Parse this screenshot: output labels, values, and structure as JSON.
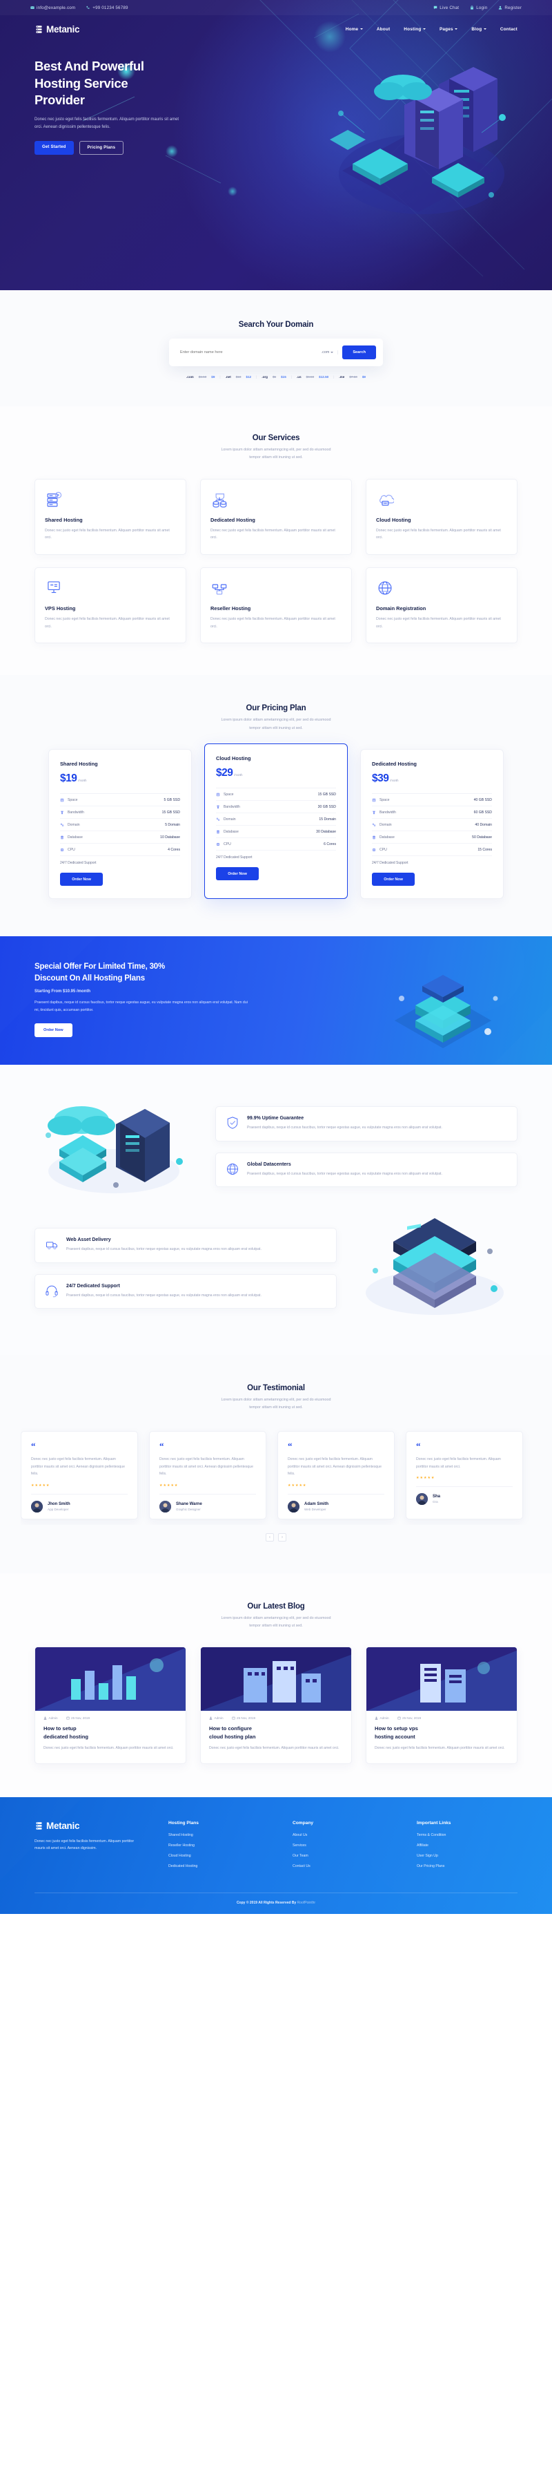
{
  "topbar": {
    "email": "info@example.com",
    "phone": "+99 01234 56789",
    "live_chat": "Live Chat",
    "login": "Login",
    "register": "Register"
  },
  "brand": {
    "name": "Metanic"
  },
  "nav": [
    {
      "label": "Home",
      "caret": true
    },
    {
      "label": "About",
      "caret": false
    },
    {
      "label": "Hosting",
      "caret": true
    },
    {
      "label": "Pages",
      "caret": true
    },
    {
      "label": "Blog",
      "caret": true
    },
    {
      "label": "Contact",
      "caret": false
    }
  ],
  "hero": {
    "title_l1": "Best And Powerful",
    "title_l2": "Hosting Service",
    "title_l3": "Provider",
    "paragraph": "Donec nec justo eget felis facilisis fermentum. Aliquam porttitor mauris sit amet orci. Aenean dignissim pellentesque felis.",
    "btn_primary": "Get Started",
    "btn_ghost": "Pricing Plans"
  },
  "search": {
    "title": "Search Your Domain",
    "placeholder": "Enter domain name here",
    "tld_selected": ".com",
    "button": "Search",
    "tlds": [
      {
        "ext": ".com",
        "old": "$6.50",
        "new": "$9"
      },
      {
        "ext": ".net",
        "old": "$10",
        "new": "$12"
      },
      {
        "ext": ".org",
        "old": "$5",
        "new": "$15"
      },
      {
        "ext": ".us",
        "old": "$6.50",
        "new": "$12.50"
      },
      {
        "ext": ".me",
        "old": "$7.50",
        "new": "$9"
      }
    ]
  },
  "services": {
    "title": "Our Services",
    "sub_l1": "Lorem ipsum dolor sittam ametamngcing elit, per sed do eiusmood",
    "sub_l2": "tempor sittam elit inuning ut sed.",
    "items": [
      {
        "icon": "server-icon",
        "title": "Shared Hosting",
        "desc": "Donec nec justo eget felis facilisis fermentum. Aliquam porttitor mauris sit amet orci."
      },
      {
        "icon": "database-icon",
        "title": "Dedicated Hosting",
        "desc": "Donec nec justo eget felis facilisis fermentum. Aliquam porttitor mauris sit amet orci."
      },
      {
        "icon": "cloud-icon",
        "title": "Cloud Hosting",
        "desc": "Donec nec justo eget felis facilisis fermentum. Aliquam porttitor mauris sit amet orci."
      },
      {
        "icon": "vps-icon",
        "title": "VPS Hosting",
        "desc": "Donec nec justo eget felis facilisis fermentum. Aliquam porttitor mauris sit amet orci."
      },
      {
        "icon": "reseller-icon",
        "title": "Reseller Hosting",
        "desc": "Donec nec justo eget felis facilisis fermentum. Aliquam porttitor mauris sit amet orci."
      },
      {
        "icon": "domain-icon",
        "title": "Domain Registration",
        "desc": "Donec nec justo eget felis facilisis fermentum. Aliquam porttitor mauris sit amet orci."
      }
    ]
  },
  "pricing": {
    "title": "Our Pricing Plan",
    "sub_l1": "Lorem ipsum dolor sittam ametamngcing elit, per sed do eiusmood",
    "sub_l2": "tempor sittam elit inuning ut sed.",
    "feature_labels": [
      "Space",
      "Bandwidth",
      "Domain",
      "Database",
      "CPU"
    ],
    "note": "24/7 Dedicated Support",
    "cta": "Order Now",
    "per": "/month",
    "plans": [
      {
        "name": "Shared Hosting",
        "price": "$19",
        "featured": false,
        "values": [
          "5 GB SSD",
          "15 GB SSD",
          "5 Domain",
          "10 Database",
          "4 Cores"
        ]
      },
      {
        "name": "Cloud Hosting",
        "price": "$29",
        "featured": true,
        "values": [
          "15 GB SSD",
          "30 GB SSD",
          "15 Domain",
          "30 Database",
          "6 Cores"
        ]
      },
      {
        "name": "Dedicated Hosting",
        "price": "$39",
        "featured": false,
        "values": [
          "40 GB SSD",
          "60 GB SSD",
          "40 Domain",
          "50 Database",
          "15 Cores"
        ]
      }
    ]
  },
  "offer": {
    "title_l1": "Special Offer For Limited Time, 30%",
    "title_l2": "Discount On All Hosting Plans",
    "starting": "Starting From $10.95 /month",
    "paragraph": "Praesent dapibus, neque id cursus faucibus, tortor neque egestas augue, eu vulputate magna eros non aliquam erat volutpat. Nam dui mi, tincidunt quis, accumsan porttitor.",
    "button": "Order Now"
  },
  "features": [
    {
      "icon": "shield-check-icon",
      "title": "99.9% Uptime Guarantee",
      "desc": "Praesent dapibus, neque id cursus faucibus, tortor neque egestas augue, eu vulputate magna eros non aliquam erat volutpat."
    },
    {
      "icon": "globe-icon",
      "title": "Global Datacenters",
      "desc": "Praesent dapibus, neque id cursus faucibus, tortor neque egestas augue, eu vulputate magna eros non aliquam erat volutpat."
    },
    {
      "icon": "delivery-icon",
      "title": "Web Asset Delivery",
      "desc": "Praesent dapibus, neque id cursus faucibus, tortor neque egestas augue, eu vulputate magna eros non aliquam erat volutpat."
    },
    {
      "icon": "headset-icon",
      "title": "24/7 Dedicated Support",
      "desc": "Praesent dapibus, neque id cursus faucibus, tortor neque egestas augue, eu vulputate magna eros non aliquam erat volutpat."
    }
  ],
  "testimonial": {
    "title": "Our Testimonial",
    "sub_l1": "Lorem ipsum dolor sittam ametamngcing elit, per sed do eiusmood",
    "sub_l2": "tempor sittam elit inuning ut sed.",
    "stars": "★★★★★",
    "prev": "‹",
    "next": "›",
    "items": [
      {
        "text": "Donec nec justo eget felis facilisis fermentum. Aliquam porttitor mauris sit amet orci. Aenean dignissim pellentesque felis.",
        "name": "Jhon Smith",
        "role": "App Developer"
      },
      {
        "text": "Donec nec justo eget felis facilisis fermentum. Aliquam porttitor mauris sit amet orci. Aenean dignissim pellentesque felis.",
        "name": "Shane Warne",
        "role": "Graphic Designer"
      },
      {
        "text": "Donec nec justo eget felis facilisis fermentum. Aliquam porttitor mauris sit amet orci. Aenean dignissim pellentesque felis.",
        "name": "Adam Smith",
        "role": "Web Developer"
      },
      {
        "text": "Donec nec justo eget felis facilisis fermentum. Aliquam porttitor mauris sit amet orci.",
        "name": "Sha",
        "role": "Gra"
      }
    ]
  },
  "blog": {
    "title": "Our Latest Blog",
    "sub_l1": "Lorem ipsum dolor sittam ametamngcing elit, per sed do eiusmood",
    "sub_l2": "tempor sittam elit inuning ut sed.",
    "posts": [
      {
        "author": "Admin",
        "date": "25 Nov, 2019",
        "title_l1": "How to setup",
        "title_l2": "dedicated hosting",
        "desc": "Donec nec justo eget felis facilisis fermentum. Aliquam porttitor mauris sit amet orci."
      },
      {
        "author": "Admin",
        "date": "25 Nov, 2019",
        "title_l1": "How to configure",
        "title_l2": "cloud hosting plan",
        "desc": "Donec nec justo eget felis facilisis fermentum. Aliquam porttitor mauris sit amet orci."
      },
      {
        "author": "Admin",
        "date": "25 Nov, 2019",
        "title_l1": "How to setup vps",
        "title_l2": "hosting account",
        "desc": "Donec nec justo eget felis facilisis fermentum. Aliquam porttitor mauris sit amet orci."
      }
    ]
  },
  "footer": {
    "about": "Donec nec justo eget felis facilisis fermentum. Aliquam porttitor mauris sit amet orci. Aenean dignissim.",
    "col_hosting_title": "Hosting Plans",
    "col_hosting": [
      "Shared Hosting",
      "Reseller Hosting",
      "Cloud Hosting",
      "Dedicated Hosting"
    ],
    "col_company_title": "Company",
    "col_company": [
      "About Us",
      "Services",
      "Our Team",
      "Contact Us"
    ],
    "col_links_title": "Important Links",
    "col_links": [
      "Terms & Condition",
      "Affiliate",
      "User Sign Up",
      "Our Pricing Plans"
    ],
    "copyright": "Copy © 2019 All Rights Reserved By",
    "by": "RoofPointhr"
  }
}
